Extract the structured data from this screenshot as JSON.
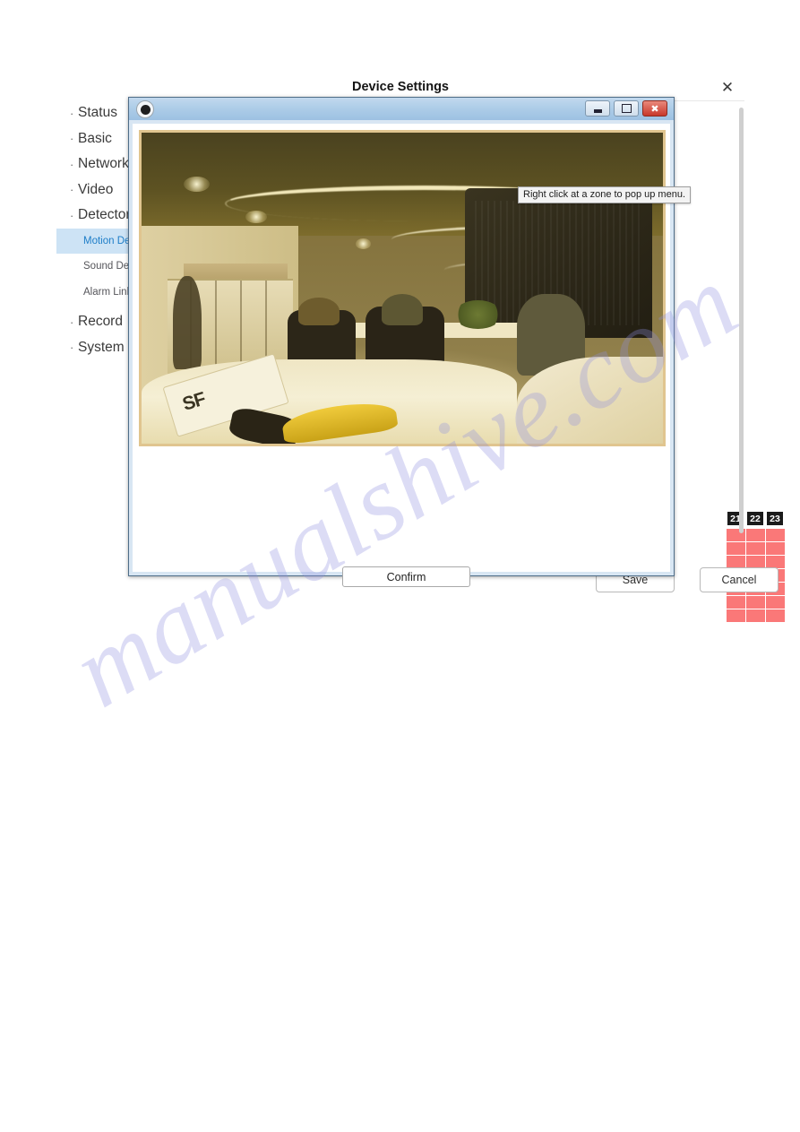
{
  "dialog": {
    "title": "Device Settings",
    "close_icon": "close-icon"
  },
  "sidebar": {
    "items": [
      {
        "label": "Status",
        "type": "top"
      },
      {
        "label": "Basic",
        "type": "top"
      },
      {
        "label": "Network",
        "type": "top"
      },
      {
        "label": "Video",
        "type": "top"
      },
      {
        "label": "Detector",
        "type": "top"
      },
      {
        "label": "Motion Detection",
        "type": "sub",
        "active": true
      },
      {
        "label": "Sound Detection",
        "type": "sub",
        "active": false
      },
      {
        "label": "Alarm Linkage",
        "type": "sub",
        "active": false
      },
      {
        "label": "Record",
        "type": "top"
      },
      {
        "label": "System",
        "type": "top"
      }
    ],
    "bullet": "·"
  },
  "schedule": {
    "hour_labels": [
      "21",
      "22",
      "23"
    ],
    "row_count": 7,
    "cell_color": "#fa7878",
    "header_bg": "#1b1b1b"
  },
  "footer": {
    "save_label": "Save",
    "cancel_label": "Cancel"
  },
  "zone_window": {
    "app_icon": "camera-icon",
    "minimize_label": "",
    "maximize_label": "",
    "close_label": "✖",
    "tooltip": "Right click at a zone to pop up menu.",
    "confirm_label": "Confirm",
    "video_sign_text": "SF"
  },
  "watermark": {
    "text": "manualshive.com",
    "color": "#8f8fe0"
  }
}
